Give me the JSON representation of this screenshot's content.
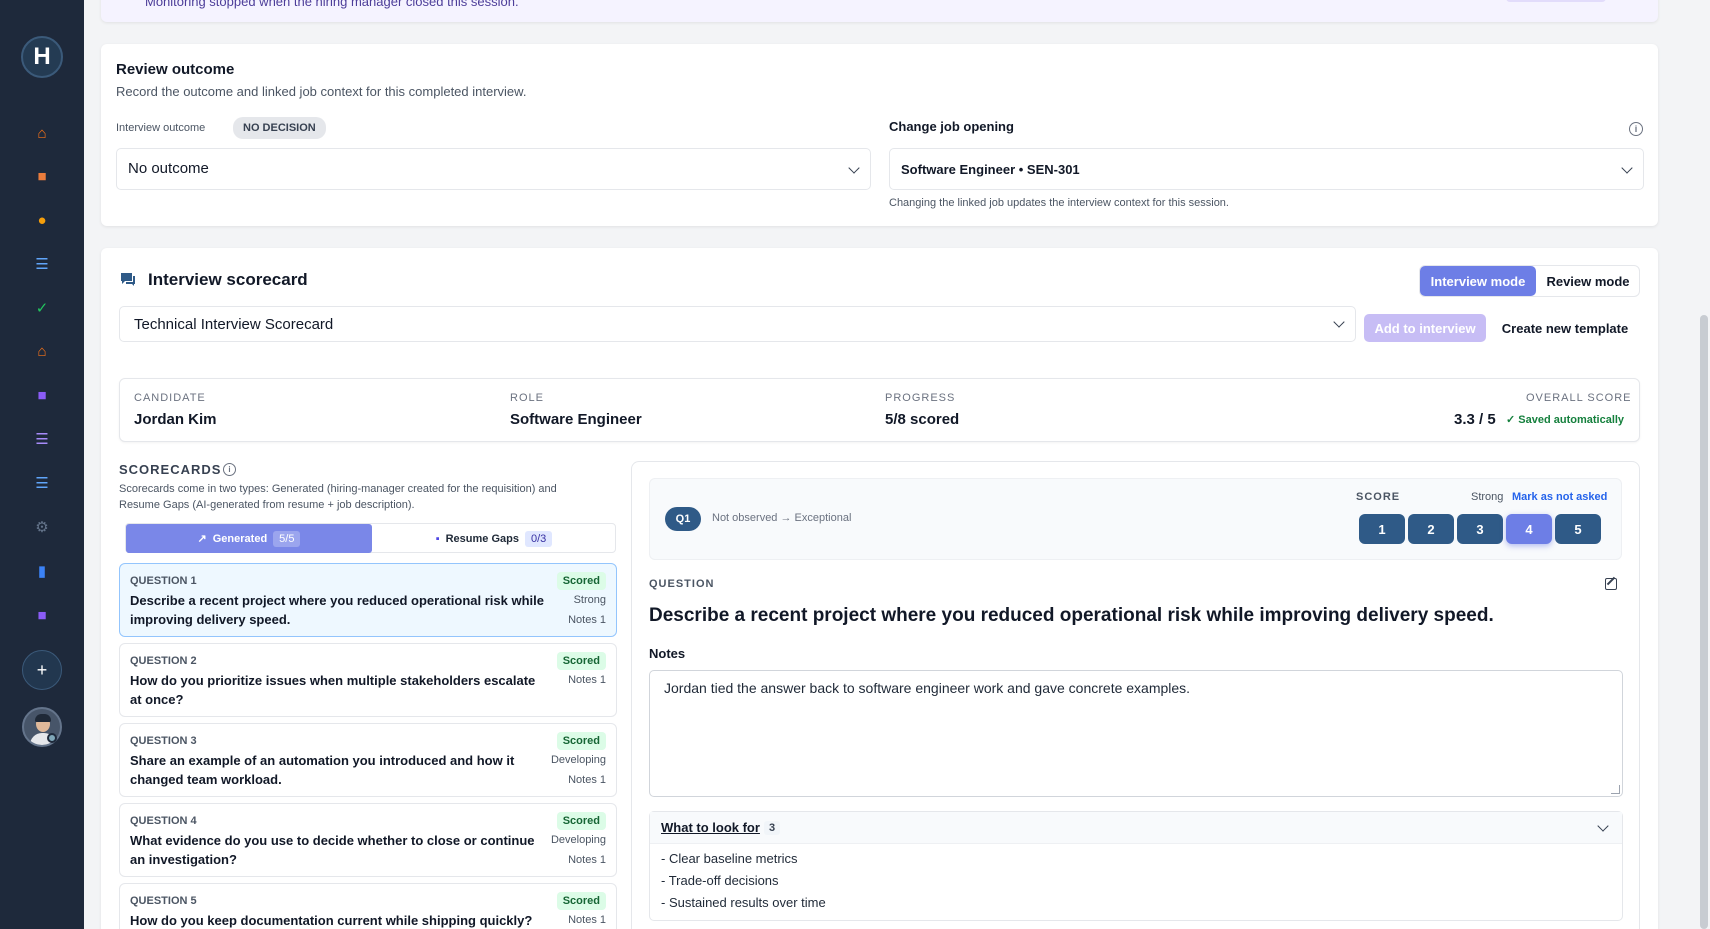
{
  "sidebar": {
    "logo_letter": "H",
    "items": [
      {
        "icon": "home-icon",
        "glyph": "⌂",
        "color": "#f97316"
      },
      {
        "icon": "briefcase-icon",
        "glyph": "■",
        "color": "#ea7c3c"
      },
      {
        "icon": "person-icon",
        "glyph": "●",
        "color": "#f59e0b"
      },
      {
        "icon": "list-icon",
        "glyph": "☰",
        "color": "#60a5fa"
      },
      {
        "icon": "check-icon",
        "glyph": "✓",
        "color": "#22c55e"
      },
      {
        "icon": "building-icon",
        "glyph": "⌂",
        "color": "#f97316"
      },
      {
        "icon": "contact-card-icon",
        "glyph": "■",
        "color": "#8b5cf6"
      },
      {
        "icon": "checklist-icon",
        "glyph": "☰",
        "color": "#a78bfa"
      },
      {
        "icon": "outline-icon",
        "glyph": "☰",
        "color": "#60a5fa"
      },
      {
        "icon": "gear-icon",
        "glyph": "⚙",
        "color": "#64748b"
      },
      {
        "icon": "bar-chart-icon",
        "glyph": "▮",
        "color": "#3b82f6"
      },
      {
        "icon": "id-badge-icon",
        "glyph": "■",
        "color": "#8b5cf6"
      }
    ],
    "add_label": "+"
  },
  "banner": {
    "text": "Monitoring stopped when the hiring manager closed this session."
  },
  "review": {
    "title": "Review outcome",
    "subtitle": "Record the outcome and linked job context for this completed interview.",
    "outcome_label": "Interview outcome",
    "decision_badge": "NO DECISION",
    "outcome_value": "No outcome",
    "job_label": "Change job opening",
    "job_value": "Software Engineer • SEN-301",
    "job_hint": "Changing the linked job updates the interview context for this session."
  },
  "scorecard": {
    "title": "Interview scorecard",
    "mode_interview": "Interview mode",
    "mode_review": "Review mode",
    "template_value": "Technical Interview Scorecard",
    "add_btn": "Add to interview",
    "create_btn": "Create new template",
    "summary": {
      "candidate_label": "CANDIDATE",
      "candidate": "Jordan Kim",
      "role_label": "ROLE",
      "role": "Software Engineer",
      "progress_label": "PROGRESS",
      "progress": "5/8 scored",
      "overall_label": "OVERALL SCORE",
      "overall": "3.3 / 5",
      "saved": "Saved automatically"
    },
    "scorecards_label": "SCORECARDS",
    "scorecards_desc": "Scorecards come in two types: Generated (hiring-manager created for the requisition) and Resume Gaps (AI-generated from resume + job description).",
    "tab_generated": "Generated",
    "tab_generated_count": "5/5",
    "tab_resume": "Resume Gaps",
    "tab_resume_count": "0/3",
    "questions": [
      {
        "num": "QUESTION 1",
        "text": "Describe a recent project where you reduced operational risk while improving delivery speed.",
        "badge": "Scored",
        "level": "Strong",
        "notes": "Notes 1"
      },
      {
        "num": "QUESTION 2",
        "text": "How do you prioritize issues when multiple stakeholders escalate at once?",
        "badge": "Scored",
        "level": "",
        "notes": "Notes 1"
      },
      {
        "num": "QUESTION 3",
        "text": "Share an example of an automation you introduced and how it changed team workload.",
        "badge": "Scored",
        "level": "Developing",
        "notes": "Notes 1"
      },
      {
        "num": "QUESTION 4",
        "text": "What evidence do you use to decide whether to close or continue an investigation?",
        "badge": "Scored",
        "level": "Developing",
        "notes": "Notes 1"
      },
      {
        "num": "QUESTION 5",
        "text": "How do you keep documentation current while shipping quickly?",
        "badge": "Scored",
        "level": "",
        "notes": "Notes 1"
      }
    ],
    "detail": {
      "pill": "Q1",
      "scale": "Not observed → Exceptional",
      "score_label": "SCORE",
      "score_level": "Strong",
      "mark_link": "Mark as not asked",
      "scores": [
        "1",
        "2",
        "3",
        "4",
        "5"
      ],
      "selected_score": 4,
      "question_label": "QUESTION",
      "question": "Describe a recent project where you reduced operational risk while improving delivery speed.",
      "notes_label": "Notes",
      "notes": "Jordan tied the answer back to software engineer work and gave concrete examples.",
      "look_title": "What to look for",
      "look_count": "3",
      "look_items": [
        "- Clear baseline metrics",
        "- Trade-off decisions",
        "- Sustained results over time"
      ]
    }
  }
}
